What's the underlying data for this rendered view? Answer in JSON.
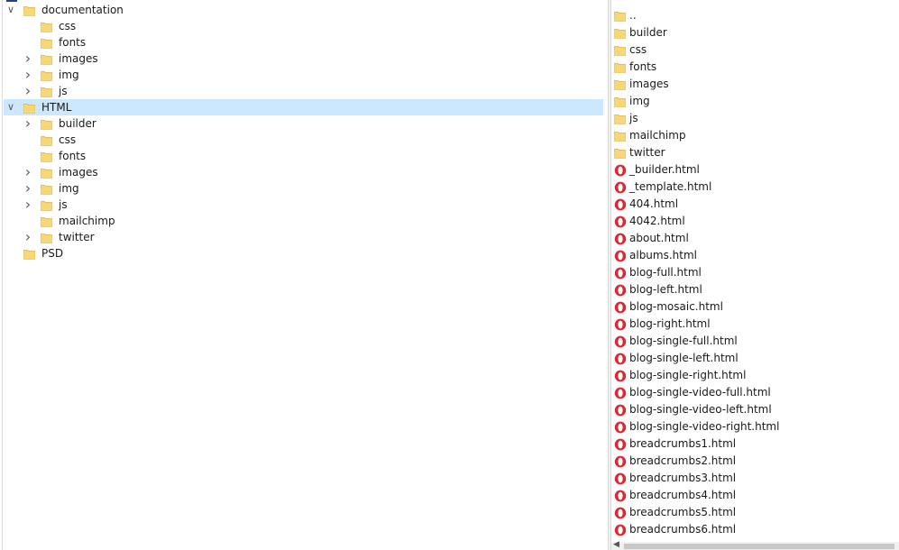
{
  "tree": {
    "selected": "HTML",
    "items": [
      {
        "label": "documentation",
        "level": 0,
        "chevron": "expanded"
      },
      {
        "label": "css",
        "level": 1,
        "chevron": "none"
      },
      {
        "label": "fonts",
        "level": 1,
        "chevron": "none"
      },
      {
        "label": "images",
        "level": 1,
        "chevron": "collapsed"
      },
      {
        "label": "img",
        "level": 1,
        "chevron": "collapsed"
      },
      {
        "label": "js",
        "level": 1,
        "chevron": "collapsed"
      },
      {
        "label": "HTML",
        "level": 0,
        "chevron": "expanded"
      },
      {
        "label": "builder",
        "level": 1,
        "chevron": "collapsed"
      },
      {
        "label": "css",
        "level": 1,
        "chevron": "none"
      },
      {
        "label": "fonts",
        "level": 1,
        "chevron": "none"
      },
      {
        "label": "images",
        "level": 1,
        "chevron": "collapsed"
      },
      {
        "label": "img",
        "level": 1,
        "chevron": "collapsed"
      },
      {
        "label": "js",
        "level": 1,
        "chevron": "collapsed"
      },
      {
        "label": "mailchimp",
        "level": 1,
        "chevron": "none"
      },
      {
        "label": "twitter",
        "level": 1,
        "chevron": "collapsed"
      },
      {
        "label": "PSD",
        "level": 0,
        "chevron": "none"
      }
    ]
  },
  "files": [
    {
      "name": "..",
      "type": "folder"
    },
    {
      "name": "builder",
      "type": "folder"
    },
    {
      "name": "css",
      "type": "folder"
    },
    {
      "name": "fonts",
      "type": "folder"
    },
    {
      "name": "images",
      "type": "folder"
    },
    {
      "name": "img",
      "type": "folder"
    },
    {
      "name": "js",
      "type": "folder"
    },
    {
      "name": "mailchimp",
      "type": "folder"
    },
    {
      "name": "twitter",
      "type": "folder"
    },
    {
      "name": "_builder.html",
      "type": "html"
    },
    {
      "name": "_template.html",
      "type": "html"
    },
    {
      "name": "404.html",
      "type": "html"
    },
    {
      "name": "4042.html",
      "type": "html"
    },
    {
      "name": "about.html",
      "type": "html"
    },
    {
      "name": "albums.html",
      "type": "html"
    },
    {
      "name": "blog-full.html",
      "type": "html"
    },
    {
      "name": "blog-left.html",
      "type": "html"
    },
    {
      "name": "blog-mosaic.html",
      "type": "html"
    },
    {
      "name": "blog-right.html",
      "type": "html"
    },
    {
      "name": "blog-single-full.html",
      "type": "html"
    },
    {
      "name": "blog-single-left.html",
      "type": "html"
    },
    {
      "name": "blog-single-right.html",
      "type": "html"
    },
    {
      "name": "blog-single-video-full.html",
      "type": "html"
    },
    {
      "name": "blog-single-video-left.html",
      "type": "html"
    },
    {
      "name": "blog-single-video-right.html",
      "type": "html"
    },
    {
      "name": "breadcrumbs1.html",
      "type": "html"
    },
    {
      "name": "breadcrumbs2.html",
      "type": "html"
    },
    {
      "name": "breadcrumbs3.html",
      "type": "html"
    },
    {
      "name": "breadcrumbs4.html",
      "type": "html"
    },
    {
      "name": "breadcrumbs5.html",
      "type": "html"
    },
    {
      "name": "breadcrumbs6.html",
      "type": "html"
    }
  ],
  "colors": {
    "selection": "#cce8ff",
    "folder": "#f8d775",
    "opera_red": "#e0262f"
  },
  "icons": {
    "folder": "folder-icon",
    "html": "opera-browser-icon",
    "expanded": "chevron-down-icon",
    "collapsed": "chevron-right-icon"
  }
}
